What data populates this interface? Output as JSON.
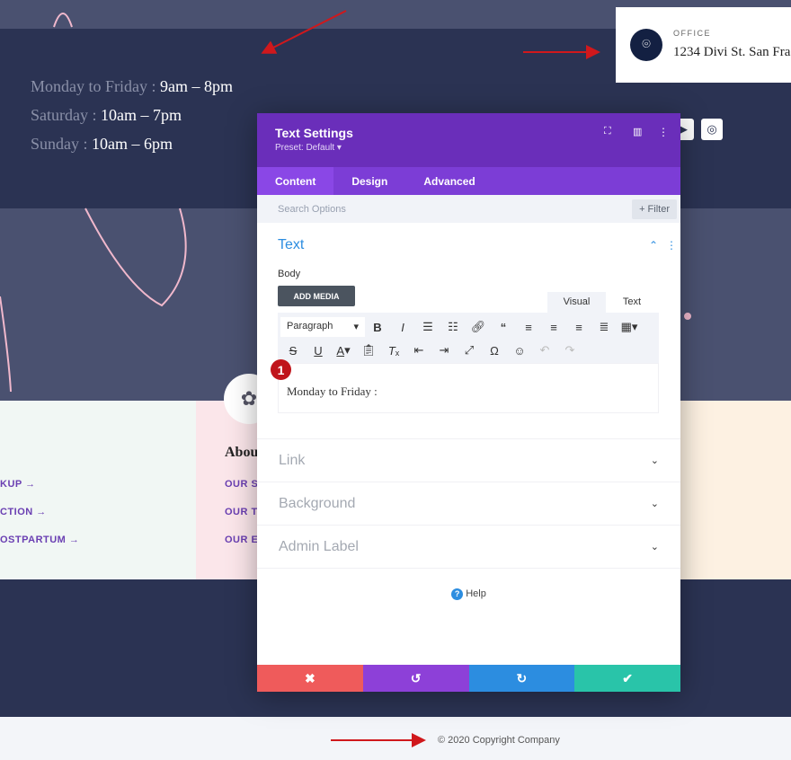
{
  "hours": [
    {
      "day": "Monday to Friday :",
      "time": "9am – 8pm"
    },
    {
      "day": "Saturday :",
      "time": "10am – 7pm"
    },
    {
      "day": "Sunday :",
      "time": "10am – 6pm"
    }
  ],
  "office": {
    "label": "OFFICE",
    "address": "1234 Divi St. San Fra",
    "icon": "map-pin-icon"
  },
  "social": [
    {
      "icon": "youtube-icon"
    },
    {
      "icon": "instagram-icon",
      "glyph": "◎"
    }
  ],
  "columns": {
    "left_links": [
      "KUP →",
      "CTION →",
      "OSTPARTUM →"
    ],
    "middle_heading": "Abou",
    "middle_links": [
      "OUR S",
      "OUR T",
      "OUR E"
    ]
  },
  "modal": {
    "title": "Text Settings",
    "preset": "Preset: Default ▾",
    "tabs": [
      "Content",
      "Design",
      "Advanced"
    ],
    "search_placeholder": "Search Options",
    "filter_label": "+ Filter",
    "text_section": "Text",
    "body_label": "Body",
    "add_media": "ADD MEDIA",
    "editor_tabs": [
      "Visual",
      "Text"
    ],
    "format_select": "Paragraph",
    "editor_content": "Monday to Friday :",
    "badge": "1",
    "sections": [
      "Link",
      "Background",
      "Admin Label"
    ],
    "help": "Help"
  },
  "footer": {
    "copyright": "© 2020 Copyright Company"
  },
  "colors": {
    "purple": "#6a2eba",
    "tabs": "#7c3dd6",
    "cancel": "#ef5b5b",
    "undo": "#8d40d8",
    "redo": "#2c8de0",
    "save": "#29c4a9",
    "arrow": "#d0181c"
  }
}
